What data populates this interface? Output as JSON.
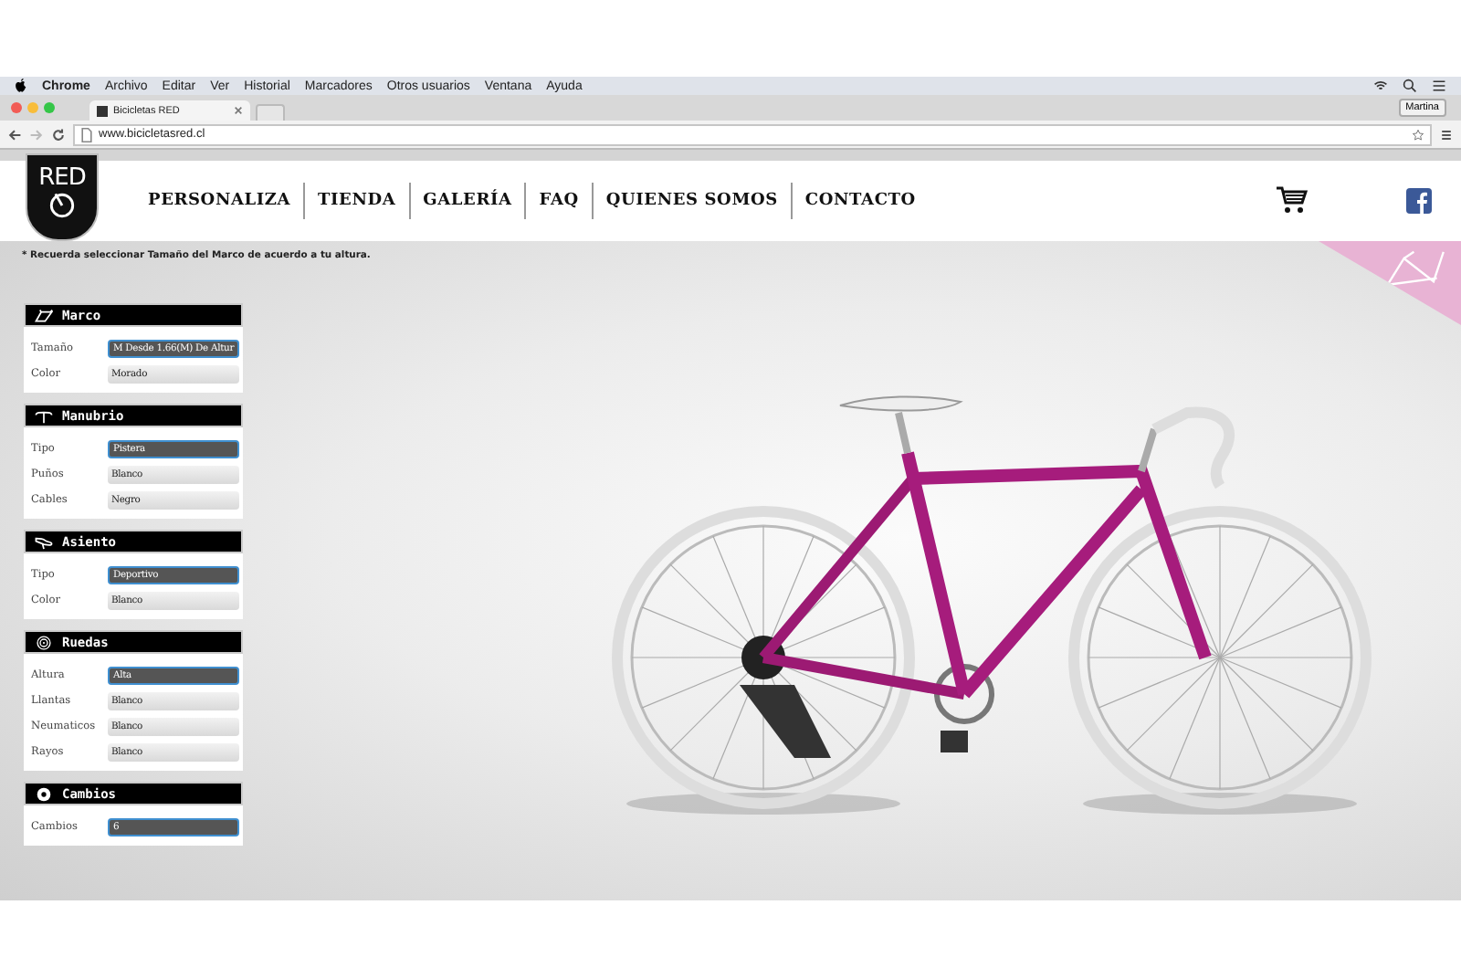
{
  "menubar": {
    "items": [
      "Chrome",
      "Archivo",
      "Editar",
      "Ver",
      "Historial",
      "Marcadores",
      "Otros usuarios",
      "Ventana",
      "Ayuda"
    ]
  },
  "browser": {
    "tab_title": "Bicicletas RED",
    "profile": "Martina",
    "url": "www.bicicletasred.cl"
  },
  "site": {
    "logo_text": "RED",
    "nav": [
      "PERSONALIZA",
      "TIENDA",
      "GALERÍA",
      "FAQ",
      "QUIENES SOMOS",
      "CONTACTO"
    ],
    "notice": "* Recuerda seleccionar Tamaño del Marco de acuerdo a tu altura."
  },
  "sections": [
    {
      "title": "Marco",
      "kind": "frame",
      "fields": [
        {
          "label": "Tamaño",
          "value": "M Desde 1.66(M) De Altur",
          "selected": true
        },
        {
          "label": "Color",
          "value": "Morado",
          "selected": false
        }
      ]
    },
    {
      "title": "Manubrio",
      "kind": "handlebar",
      "fields": [
        {
          "label": "Tipo",
          "value": "Pistera",
          "selected": true
        },
        {
          "label": "Puños",
          "value": "Blanco",
          "selected": false
        },
        {
          "label": "Cables",
          "value": "Negro",
          "selected": false
        }
      ]
    },
    {
      "title": "Asiento",
      "kind": "seat",
      "fields": [
        {
          "label": "Tipo",
          "value": "Deportivo",
          "selected": true
        },
        {
          "label": "Color",
          "value": "Blanco",
          "selected": false
        }
      ]
    },
    {
      "title": "Ruedas",
      "kind": "wheel",
      "fields": [
        {
          "label": "Altura",
          "value": "Alta",
          "selected": true
        },
        {
          "label": "Llantas",
          "value": "Blanco",
          "selected": false
        },
        {
          "label": "Neumaticos",
          "value": "Blanco",
          "selected": false
        },
        {
          "label": "Rayos",
          "value": "Blanco",
          "selected": false
        }
      ]
    },
    {
      "title": "Cambios",
      "kind": "gears",
      "fields": [
        {
          "label": "Cambios",
          "value": "6",
          "selected": true
        }
      ]
    }
  ]
}
